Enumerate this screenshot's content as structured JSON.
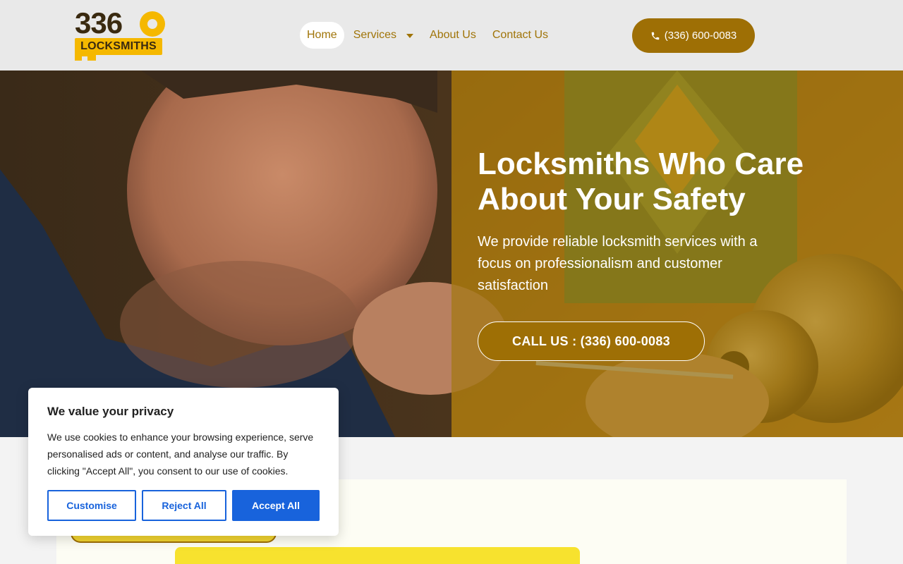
{
  "brand": {
    "logo_digits": "336",
    "logo_word": "LOCKSMITHS",
    "accent_color": "#9e6f05",
    "highlight_color": "#f5b800"
  },
  "nav": {
    "items": [
      {
        "label": "Home",
        "active": true
      },
      {
        "label": "Services",
        "has_dropdown": true
      },
      {
        "label": "About Us"
      },
      {
        "label": "Contact Us"
      }
    ]
  },
  "header": {
    "phone_label": "(336) 600-0083",
    "phone_icon": "phone-icon"
  },
  "hero": {
    "title": "Locksmiths Who Care About Your Safety",
    "subtitle": "We provide reliable locksmith services with a focus on professionalism and customer satisfaction",
    "cta_label": "CALL US : (336) 600-0083"
  },
  "cookie": {
    "title": "We value your privacy",
    "description": "We use cookies to enhance your browsing experience, serve personalised ads or content, and analyse our traffic. By clicking \"Accept All\", you consent to our use of cookies.",
    "customise_label": "Customise",
    "reject_label": "Reject All",
    "accept_label": "Accept All",
    "button_color": "#1863dc"
  }
}
